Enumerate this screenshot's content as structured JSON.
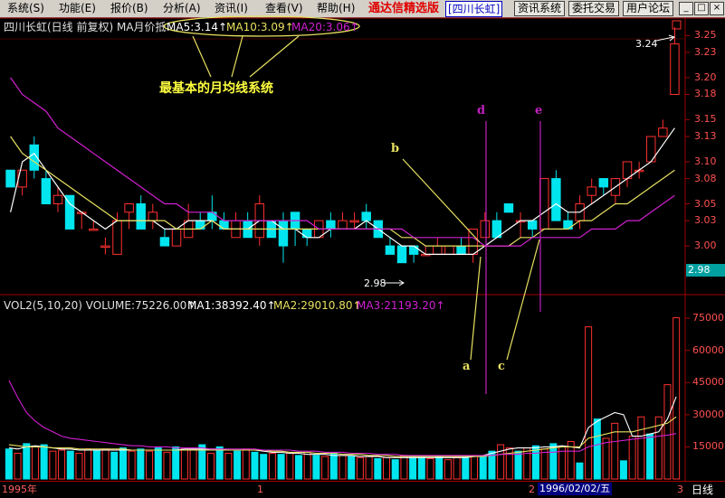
{
  "menu": [
    {
      "label": "系统(S)"
    },
    {
      "label": "功能(E)"
    },
    {
      "label": "报价(B)"
    },
    {
      "label": "分析(A)"
    },
    {
      "label": "资讯(I)"
    },
    {
      "label": "查看(V)"
    },
    {
      "label": "帮助(H)"
    }
  ],
  "brand": {
    "name": "通达信精选版",
    "stock": "[四川长虹]"
  },
  "toolbar": {
    "info": "资讯系统",
    "trade": "委托交易",
    "forum": "用户论坛"
  },
  "window_buttons": {
    "min": "_",
    "restore": "□",
    "close": "×"
  },
  "price_header": {
    "title": "四川长虹(日线 前复权) MA月价抵",
    "ma5": "MA5:3.14↑",
    "ma10": "MA10:3.09↑",
    "ma20": "MA20:3.06↑"
  },
  "annotation": {
    "caption": "最基本的月均线系统",
    "a": "a",
    "b": "b",
    "c": "c",
    "d": "d",
    "e": "e",
    "high_label": "3.24",
    "low_label": "2.98"
  },
  "price_axis": {
    "ticks": [
      "3.25",
      "3.23",
      "3.20",
      "3.18",
      "3.15",
      "3.13",
      "3.10",
      "3.08",
      "3.05",
      "3.03",
      "3.00"
    ],
    "current": "2.98"
  },
  "volume_header": {
    "title": "VOL2(5,10,20)  VOLUME:75226.00↑",
    "ma1": "MA1:38392.40↑",
    "ma2": "MA2:29010.80↑",
    "ma3": "MA3:21193.20↑"
  },
  "volume_axis": {
    "ticks": [
      "75000",
      "60000",
      "45000",
      "30000",
      "15000"
    ]
  },
  "bottom": {
    "year": "1995年",
    "mark1": "1",
    "mark2": "2",
    "date": "1996/02/02/五",
    "mark3": "3",
    "period": "日线"
  },
  "colors": {
    "up": "#ff3030",
    "down": "#00e5ee",
    "ma5": "#ffffff",
    "ma10": "#e8e060",
    "ma20": "#d020d0",
    "annotation": "#e8e060",
    "vline": "#c020c0"
  },
  "chart_data": {
    "type": "candlestick",
    "ylim": [
      2.97,
      3.26
    ],
    "candles": [
      {
        "o": 3.09,
        "h": 3.09,
        "l": 3.07,
        "c": 3.07
      },
      {
        "o": 3.07,
        "h": 3.09,
        "l": 3.06,
        "c": 3.09
      },
      {
        "o": 3.12,
        "h": 3.13,
        "l": 3.08,
        "c": 3.09
      },
      {
        "o": 3.08,
        "h": 3.09,
        "l": 3.06,
        "c": 3.05
      },
      {
        "o": 3.05,
        "h": 3.07,
        "l": 3.04,
        "c": 3.06
      },
      {
        "o": 3.06,
        "h": 3.06,
        "l": 3.02,
        "c": 3.02
      },
      {
        "o": 3.04,
        "h": 3.04,
        "l": 3.02,
        "c": 3.04
      },
      {
        "o": 3.02,
        "h": 3.03,
        "l": 3.02,
        "c": 3.02
      },
      {
        "o": 3.0,
        "h": 3.01,
        "l": 2.99,
        "c": 3.0
      },
      {
        "o": 2.99,
        "h": 3.04,
        "l": 2.99,
        "c": 3.03
      },
      {
        "o": 3.04,
        "h": 3.05,
        "l": 3.02,
        "c": 3.05
      },
      {
        "o": 3.05,
        "h": 3.06,
        "l": 3.02,
        "c": 3.02
      },
      {
        "o": 3.03,
        "h": 3.05,
        "l": 3.02,
        "c": 3.04
      },
      {
        "o": 3.01,
        "h": 3.02,
        "l": 3.0,
        "c": 3.0
      },
      {
        "o": 3.0,
        "h": 3.02,
        "l": 3.0,
        "c": 3.02
      },
      {
        "o": 3.01,
        "h": 3.05,
        "l": 3.01,
        "c": 3.03
      },
      {
        "o": 3.03,
        "h": 3.04,
        "l": 3.02,
        "c": 3.02
      },
      {
        "o": 3.04,
        "h": 3.06,
        "l": 3.02,
        "c": 3.03
      },
      {
        "o": 3.03,
        "h": 3.04,
        "l": 3.02,
        "c": 3.02
      },
      {
        "o": 3.01,
        "h": 3.04,
        "l": 3.01,
        "c": 3.03
      },
      {
        "o": 3.03,
        "h": 3.04,
        "l": 3.01,
        "c": 3.01
      },
      {
        "o": 3.01,
        "h": 3.06,
        "l": 3.0,
        "c": 3.05
      },
      {
        "o": 3.03,
        "h": 3.03,
        "l": 3.01,
        "c": 3.01
      },
      {
        "o": 3.03,
        "h": 3.04,
        "l": 2.98,
        "c": 3.0
      },
      {
        "o": 3.04,
        "h": 3.04,
        "l": 3.0,
        "c": 3.02
      },
      {
        "o": 3.02,
        "h": 3.02,
        "l": 3.0,
        "c": 3.01
      },
      {
        "o": 3.01,
        "h": 3.03,
        "l": 3.01,
        "c": 3.03
      },
      {
        "o": 3.03,
        "h": 3.04,
        "l": 3.01,
        "c": 3.02
      },
      {
        "o": 3.02,
        "h": 3.04,
        "l": 3.02,
        "c": 3.03
      },
      {
        "o": 3.03,
        "h": 3.04,
        "l": 3.02,
        "c": 3.03
      },
      {
        "o": 3.04,
        "h": 3.05,
        "l": 3.02,
        "c": 3.03
      },
      {
        "o": 3.03,
        "h": 3.03,
        "l": 3.01,
        "c": 3.01
      },
      {
        "o": 3.0,
        "h": 3.01,
        "l": 2.99,
        "c": 2.99
      },
      {
        "o": 3.0,
        "h": 3.0,
        "l": 2.98,
        "c": 2.98
      },
      {
        "o": 3.0,
        "h": 3.0,
        "l": 2.98,
        "c": 2.99
      },
      {
        "o": 2.99,
        "h": 3.0,
        "l": 2.99,
        "c": 2.99
      },
      {
        "o": 2.99,
        "h": 3.01,
        "l": 2.99,
        "c": 3.0
      },
      {
        "o": 2.99,
        "h": 3.0,
        "l": 2.99,
        "c": 3.0
      },
      {
        "o": 3.0,
        "h": 3.01,
        "l": 2.99,
        "c": 2.99
      },
      {
        "o": 2.99,
        "h": 3.02,
        "l": 2.98,
        "c": 3.02
      },
      {
        "o": 3.01,
        "h": 3.04,
        "l": 3.01,
        "c": 3.03
      },
      {
        "o": 3.03,
        "h": 3.04,
        "l": 3.01,
        "c": 3.01
      },
      {
        "o": 3.05,
        "h": 3.05,
        "l": 3.04,
        "c": 3.04
      },
      {
        "o": 3.03,
        "h": 3.04,
        "l": 3.01,
        "c": 3.03
      },
      {
        "o": 3.03,
        "h": 3.03,
        "l": 3.01,
        "c": 3.02
      },
      {
        "o": 3.02,
        "h": 3.08,
        "l": 3.02,
        "c": 3.08
      },
      {
        "o": 3.08,
        "h": 3.09,
        "l": 3.03,
        "c": 3.03
      },
      {
        "o": 3.03,
        "h": 3.04,
        "l": 3.02,
        "c": 3.02
      },
      {
        "o": 3.03,
        "h": 3.06,
        "l": 3.02,
        "c": 3.05
      },
      {
        "o": 3.06,
        "h": 3.08,
        "l": 3.05,
        "c": 3.07
      },
      {
        "o": 3.08,
        "h": 3.08,
        "l": 3.06,
        "c": 3.07
      },
      {
        "o": 3.06,
        "h": 3.08,
        "l": 3.05,
        "c": 3.08
      },
      {
        "o": 3.08,
        "h": 3.1,
        "l": 3.07,
        "c": 3.1
      },
      {
        "o": 3.09,
        "h": 3.1,
        "l": 3.08,
        "c": 3.09
      },
      {
        "o": 3.1,
        "h": 3.13,
        "l": 3.1,
        "c": 3.13
      },
      {
        "o": 3.13,
        "h": 3.15,
        "l": 3.13,
        "c": 3.14
      },
      {
        "o": 3.18,
        "h": 3.26,
        "l": 3.18,
        "c": 3.24
      }
    ],
    "volume_ylim": [
      0,
      78000
    ],
    "volume": [
      14000,
      12000,
      16500,
      15000,
      16000,
      13000,
      13500,
      13000,
      12000,
      14000,
      13500,
      14000,
      12500,
      14500,
      13000,
      14000,
      13000,
      14500,
      12500,
      15000,
      14500,
      14000,
      16000,
      12000,
      15000,
      12000,
      13000,
      14000,
      12500,
      11500,
      12000,
      11500,
      12000,
      11000,
      12500,
      11000,
      10500,
      12000,
      11000,
      10500,
      10000,
      10500,
      9500,
      10000,
      9000,
      11000,
      10000,
      10000,
      9500,
      10500,
      9000,
      10000,
      10500,
      11000,
      11000,
      13000,
      16000,
      14500,
      13000,
      14500,
      15500,
      14000,
      16500,
      15000,
      17500,
      7500,
      71000,
      28000,
      19000,
      26000,
      8500,
      20000,
      29000,
      21000,
      29000,
      44000,
      75226
    ],
    "volume_dir": [
      "d",
      "u",
      "d",
      "u",
      "d",
      "u",
      "u",
      "d",
      "u",
      "u",
      "d",
      "u",
      "d",
      "d",
      "u",
      "d",
      "u",
      "d",
      "u",
      "d",
      "u",
      "u",
      "d",
      "u",
      "d",
      "u",
      "d",
      "u",
      "d",
      "d",
      "u",
      "d",
      "u",
      "d",
      "u",
      "d",
      "u",
      "d",
      "u",
      "d",
      "u",
      "u",
      "d",
      "u",
      "d",
      "u",
      "d",
      "d",
      "u",
      "d",
      "u",
      "u",
      "d",
      "u",
      "d",
      "d",
      "u",
      "u",
      "d",
      "u",
      "d",
      "u",
      "d",
      "u",
      "u",
      "d",
      "u",
      "d",
      "u",
      "u",
      "d",
      "u",
      "u",
      "d",
      "u",
      "u",
      "u"
    ],
    "series": [
      {
        "name": "MA5",
        "values": [
          3.04,
          3.1,
          3.11,
          3.09,
          3.07,
          3.05,
          3.04,
          3.03,
          3.02,
          3.03,
          3.03,
          3.03,
          3.03,
          3.02,
          3.02,
          3.03,
          3.03,
          3.03,
          3.02,
          3.02,
          3.02,
          3.03,
          3.03,
          3.02,
          3.02,
          3.01,
          3.01,
          3.02,
          3.02,
          3.02,
          3.03,
          3.02,
          3.01,
          3.0,
          3.0,
          2.99,
          2.99,
          2.99,
          2.99,
          2.99,
          3.0,
          3.01,
          3.02,
          3.03,
          3.03,
          3.04,
          3.05,
          3.04,
          3.04,
          3.05,
          3.06,
          3.07,
          3.08,
          3.09,
          3.1,
          3.12,
          3.14
        ]
      },
      {
        "name": "MA10",
        "values": [
          3.13,
          3.11,
          3.1,
          3.09,
          3.08,
          3.07,
          3.06,
          3.05,
          3.04,
          3.03,
          3.03,
          3.03,
          3.03,
          3.03,
          3.02,
          3.02,
          3.02,
          3.03,
          3.02,
          3.02,
          3.02,
          3.02,
          3.02,
          3.02,
          3.02,
          3.02,
          3.02,
          3.02,
          3.02,
          3.02,
          3.02,
          3.02,
          3.02,
          3.01,
          3.01,
          3.0,
          3.0,
          3.0,
          3.0,
          3.0,
          3.0,
          3.0,
          3.0,
          3.01,
          3.01,
          3.02,
          3.02,
          3.02,
          3.03,
          3.03,
          3.04,
          3.05,
          3.05,
          3.06,
          3.07,
          3.08,
          3.09
        ]
      },
      {
        "name": "MA20",
        "values": [
          3.2,
          3.18,
          3.17,
          3.16,
          3.14,
          3.13,
          3.12,
          3.11,
          3.1,
          3.09,
          3.08,
          3.07,
          3.06,
          3.05,
          3.05,
          3.04,
          3.04,
          3.04,
          3.03,
          3.03,
          3.03,
          3.03,
          3.03,
          3.03,
          3.03,
          3.03,
          3.02,
          3.02,
          3.02,
          3.02,
          3.02,
          3.02,
          3.02,
          3.02,
          3.01,
          3.01,
          3.01,
          3.01,
          3.01,
          3.01,
          3.0,
          3.0,
          3.0,
          3.0,
          3.01,
          3.01,
          3.01,
          3.01,
          3.01,
          3.02,
          3.02,
          3.02,
          3.03,
          3.03,
          3.04,
          3.05,
          3.06
        ]
      }
    ],
    "volume_series": [
      {
        "name": "MA1",
        "values": [
          14500,
          14000,
          15000,
          15500,
          15000,
          14500,
          14000,
          14000,
          13500,
          13500,
          13500,
          13500,
          13500,
          13500,
          13500,
          13500,
          13500,
          13500,
          13500,
          13500,
          14000,
          14000,
          14000,
          14000,
          14000,
          13500,
          13500,
          13500,
          13500,
          13000,
          12500,
          12500,
          12000,
          12000,
          11500,
          11500,
          11500,
          11000,
          11000,
          11000,
          10500,
          10500,
          10500,
          10000,
          10000,
          10000,
          10000,
          10000,
          10000,
          10000,
          10000,
          10000,
          10000,
          10500,
          11000,
          12000,
          13000,
          14000,
          14500,
          14500,
          14500,
          15000,
          15000,
          15500,
          15000,
          14500,
          24000,
          27000,
          29000,
          31000,
          30000,
          20000,
          20000,
          21000,
          22000,
          28000,
          38392
        ]
      },
      {
        "name": "MA2",
        "values": [
          16000,
          15500,
          15000,
          15000,
          15000,
          14500,
          14500,
          14500,
          14000,
          14000,
          14000,
          14000,
          14000,
          14000,
          13500,
          13500,
          13500,
          13500,
          13500,
          13500,
          13500,
          13500,
          13500,
          13500,
          13500,
          13500,
          13500,
          13500,
          13500,
          13500,
          13000,
          13000,
          12500,
          12500,
          12500,
          12000,
          12000,
          12000,
          11500,
          11500,
          11500,
          11000,
          11000,
          11000,
          10500,
          10500,
          10500,
          10500,
          10500,
          10500,
          10500,
          10500,
          10500,
          10500,
          10500,
          11000,
          11500,
          12000,
          12500,
          13000,
          13500,
          14000,
          14500,
          15000,
          15000,
          15000,
          19000,
          20000,
          21000,
          22000,
          22000,
          22000,
          23000,
          24000,
          25000,
          26000,
          29010
        ]
      },
      {
        "name": "MA3",
        "values": [
          46000,
          38000,
          31000,
          27000,
          24000,
          22000,
          20000,
          19000,
          18500,
          18000,
          17500,
          17000,
          16500,
          16000,
          15500,
          15500,
          15000,
          15000,
          15000,
          14500,
          14500,
          14500,
          14500,
          14000,
          14000,
          14000,
          14000,
          14000,
          14000,
          13500,
          13500,
          13500,
          13500,
          13000,
          13000,
          13000,
          12500,
          12500,
          12500,
          12000,
          12000,
          12000,
          11500,
          11500,
          11500,
          11000,
          11000,
          11000,
          11000,
          11000,
          11000,
          11000,
          11000,
          11000,
          11000,
          11000,
          11500,
          11500,
          11500,
          12000,
          12000,
          12500,
          12500,
          13000,
          13000,
          13000,
          15000,
          16000,
          17000,
          17500,
          18000,
          18500,
          19000,
          19500,
          20000,
          20500,
          21193
        ]
      }
    ]
  }
}
